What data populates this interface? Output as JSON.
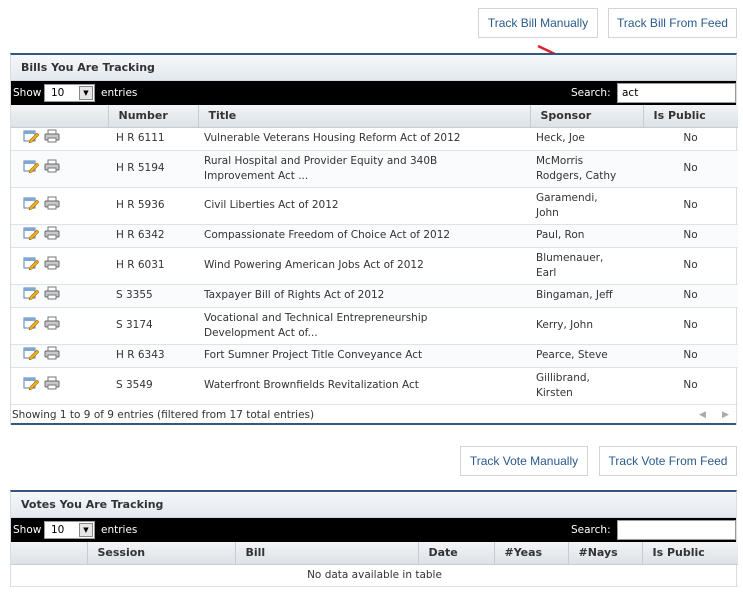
{
  "bill_buttons": {
    "track_manual": "Track Bill Manually",
    "track_feed": "Track Bill From Feed"
  },
  "bills_panel": {
    "title": "Bills You Are Tracking",
    "show_label": "Show",
    "entries_value": "10",
    "entries_label": "entries",
    "search_label": "Search:",
    "search_value": "act",
    "columns": [
      "Number",
      "Title",
      "Sponsor",
      "Is Public"
    ],
    "rows": [
      {
        "number": "H R 6111",
        "title": [
          "Vulnerable Veterans Housing Reform Act of 2012"
        ],
        "sponsor": [
          "Heck, Joe"
        ],
        "public": "No"
      },
      {
        "number": "H R 5194",
        "title": [
          "Rural Hospital and Provider Equity and 340B",
          "Improvement Act ..."
        ],
        "sponsor": [
          "McMorris",
          "Rodgers, Cathy"
        ],
        "public": "No"
      },
      {
        "number": "H R 5936",
        "title": [
          "Civil Liberties Act of 2012"
        ],
        "sponsor": [
          "Garamendi,",
          "John"
        ],
        "public": "No"
      },
      {
        "number": "H R 6342",
        "title": [
          "Compassionate Freedom of Choice Act of 2012"
        ],
        "sponsor": [
          "Paul, Ron"
        ],
        "public": "No"
      },
      {
        "number": "H R 6031",
        "title": [
          "Wind Powering American Jobs Act of 2012"
        ],
        "sponsor": [
          "Blumenauer,",
          "Earl"
        ],
        "public": "No"
      },
      {
        "number": "S 3355",
        "title": [
          "Taxpayer Bill of Rights Act of 2012"
        ],
        "sponsor": [
          "Bingaman, Jeff"
        ],
        "public": "No"
      },
      {
        "number": "S 3174",
        "title": [
          "Vocational and Technical Entrepreneurship",
          "Development Act of..."
        ],
        "sponsor": [
          "Kerry, John"
        ],
        "public": "No"
      },
      {
        "number": "H R 6343",
        "title": [
          "Fort Sumner Project Title Conveyance Act"
        ],
        "sponsor": [
          "Pearce, Steve"
        ],
        "public": "No"
      },
      {
        "number": "S 3549",
        "title": [
          "Waterfront Brownfields Revitalization Act"
        ],
        "sponsor": [
          "Gillibrand,",
          "Kirsten"
        ],
        "public": "No"
      }
    ],
    "footer": "Showing 1 to 9 of 9 entries (filtered from 17 total entries)",
    "prev": "◀",
    "next": "▶"
  },
  "vote_buttons": {
    "track_manual": "Track Vote Manually",
    "track_feed": "Track Vote From Feed"
  },
  "votes_panel": {
    "title": "Votes You Are Tracking",
    "show_label": "Show",
    "entries_value": "10",
    "entries_label": "entries",
    "search_label": "Search:",
    "search_value": "",
    "columns": [
      "Session",
      "Bill",
      "Date",
      "#Yeas",
      "#Nays",
      "Is Public"
    ],
    "empty": "No data available in table"
  },
  "colors": {
    "accent": "#32587f",
    "link": "#2a5a8c",
    "arrow": "#e0202a"
  },
  "icons": [
    "edit-icon",
    "print-icon",
    "arrow-annotation"
  ]
}
